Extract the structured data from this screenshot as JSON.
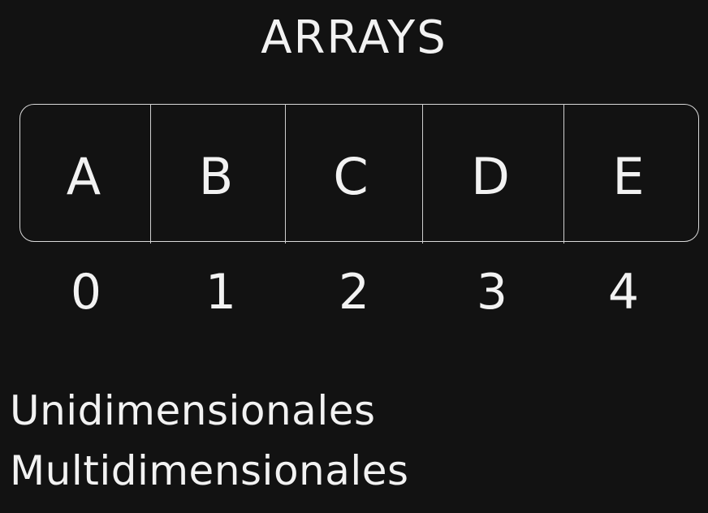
{
  "title": "ARRAYS",
  "cells": [
    "A",
    "B",
    "C",
    "D",
    "E"
  ],
  "indices": [
    "0",
    "1",
    "2",
    "3",
    "4"
  ],
  "types": [
    "Unidimensionales",
    "Multidimensionales"
  ]
}
